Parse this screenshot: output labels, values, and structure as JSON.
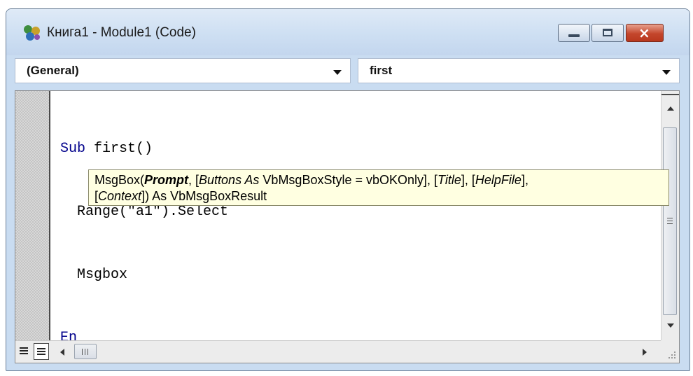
{
  "window": {
    "title": "Книга1 - Module1 (Code)",
    "icon": "vba-module-icon",
    "controls": {
      "minimize": "minimize",
      "maximize": "maximize",
      "close": "×"
    }
  },
  "combos": {
    "object": "(General)",
    "procedure": "first"
  },
  "code": {
    "lines": [
      {
        "keyword": "Sub",
        "rest": " first()"
      },
      {
        "keyword": "",
        "rest": "  Range(\"a1\").Select"
      },
      {
        "keyword": "",
        "rest": "  Msgbox"
      },
      {
        "keyword": "En",
        "rest": ""
      }
    ]
  },
  "tooltip": {
    "func": "MsgBox(",
    "prompt": "Prompt",
    "sep1": ", [",
    "buttons": "Buttons As",
    "buttons_type": " VbMsgBoxStyle = vbOKOnly], [",
    "title": "Title",
    "sep2": "], [",
    "helpfile": "HelpFile",
    "sep3": "],",
    "line2_open": "[",
    "context": "Context",
    "line2_rest": "]) As VbMsgBoxResult"
  },
  "colors": {
    "keyword": "#00008b",
    "tooltip_bg": "#ffffe1",
    "frame": "#c9dcf1",
    "close_button": "#c4462c"
  }
}
